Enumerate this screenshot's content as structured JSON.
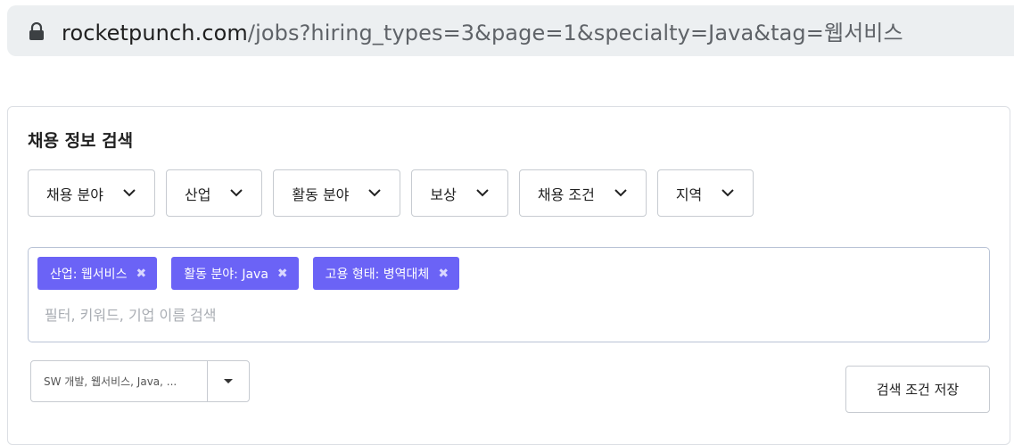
{
  "browser": {
    "url_host": "rocketpunch.com",
    "url_path": "/jobs?hiring_types=3&page=1&specialty=Java&tag=웹서비스",
    "lock_icon": "lock-icon"
  },
  "search_panel": {
    "title": "채용 정보 검색",
    "filters": [
      {
        "label": "채용 분야",
        "icon": "chevron-down-icon"
      },
      {
        "label": "산업",
        "icon": "chevron-down-icon"
      },
      {
        "label": "활동 분야",
        "icon": "chevron-down-icon"
      },
      {
        "label": "보상",
        "icon": "chevron-down-icon"
      },
      {
        "label": "채용 조건",
        "icon": "chevron-down-icon"
      },
      {
        "label": "지역",
        "icon": "chevron-down-icon"
      }
    ],
    "active_tags": [
      {
        "label": "산업: 웹서비스",
        "remove_icon": "close-icon"
      },
      {
        "label": "활동 분야: Java",
        "remove_icon": "close-icon"
      },
      {
        "label": "고용 형태: 병역대체",
        "remove_icon": "close-icon"
      }
    ],
    "tag_input": {
      "value": "",
      "placeholder": "필터, 키워드, 기업 이름 검색"
    },
    "saved_search_select": {
      "selected": "SW 개발, 웹서비스, Java, ...",
      "icon": "caret-down-icon"
    },
    "save_button_label": "검색 조건 저장"
  },
  "colors": {
    "tag_bg": "#6b63f6",
    "url_bar_bg": "#eceff1",
    "border": "#c7cbd1"
  }
}
